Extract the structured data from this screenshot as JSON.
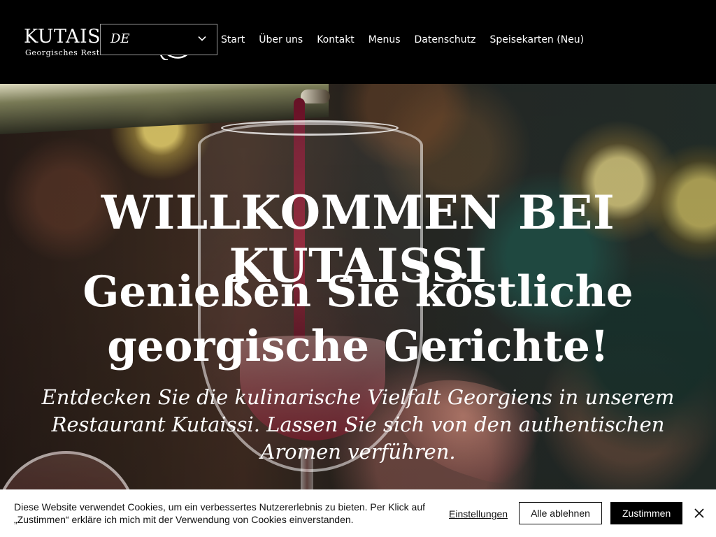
{
  "header": {
    "logo_text": "KUTAISSI",
    "logo_tagline": "Georgisches Restaurant",
    "language": "DE",
    "nav": [
      "Start",
      "Über uns",
      "Kontakt",
      "Menus",
      "Datenschutz",
      "Speisekarten (Neu)"
    ],
    "icons": {
      "language_dropdown": "chevron-down-icon",
      "logo_mark": "emblem-icon"
    }
  },
  "hero": {
    "title": "WILLKOMMEN BEI KUTAISSI",
    "subtitle": "Genießen Sie köstliche georgische Gerichte!",
    "text": "Entdecken Sie die kulinarische Vielfalt Georgiens in unserem Restaurant Kutaissi. Lassen Sie sich von den authentischen Aromen verführen."
  },
  "cookie_banner": {
    "text": "Diese Website verwendet Cookies, um ein verbessertes Nutzererlebnis zu bieten. Per Klick auf „Zustimmen“ erkläre ich mich mit der Verwendung von Cookies einverstanden.",
    "settings_label": "Einstellungen",
    "decline_label": "Alle ablehnen",
    "accept_label": "Zustimmen",
    "close_icon": "close-icon"
  },
  "colors": {
    "header_bg": "#000000",
    "accent_text": "#FFFFFF",
    "cookie_bg": "#FFFFFF",
    "primary_button": "#000000"
  }
}
